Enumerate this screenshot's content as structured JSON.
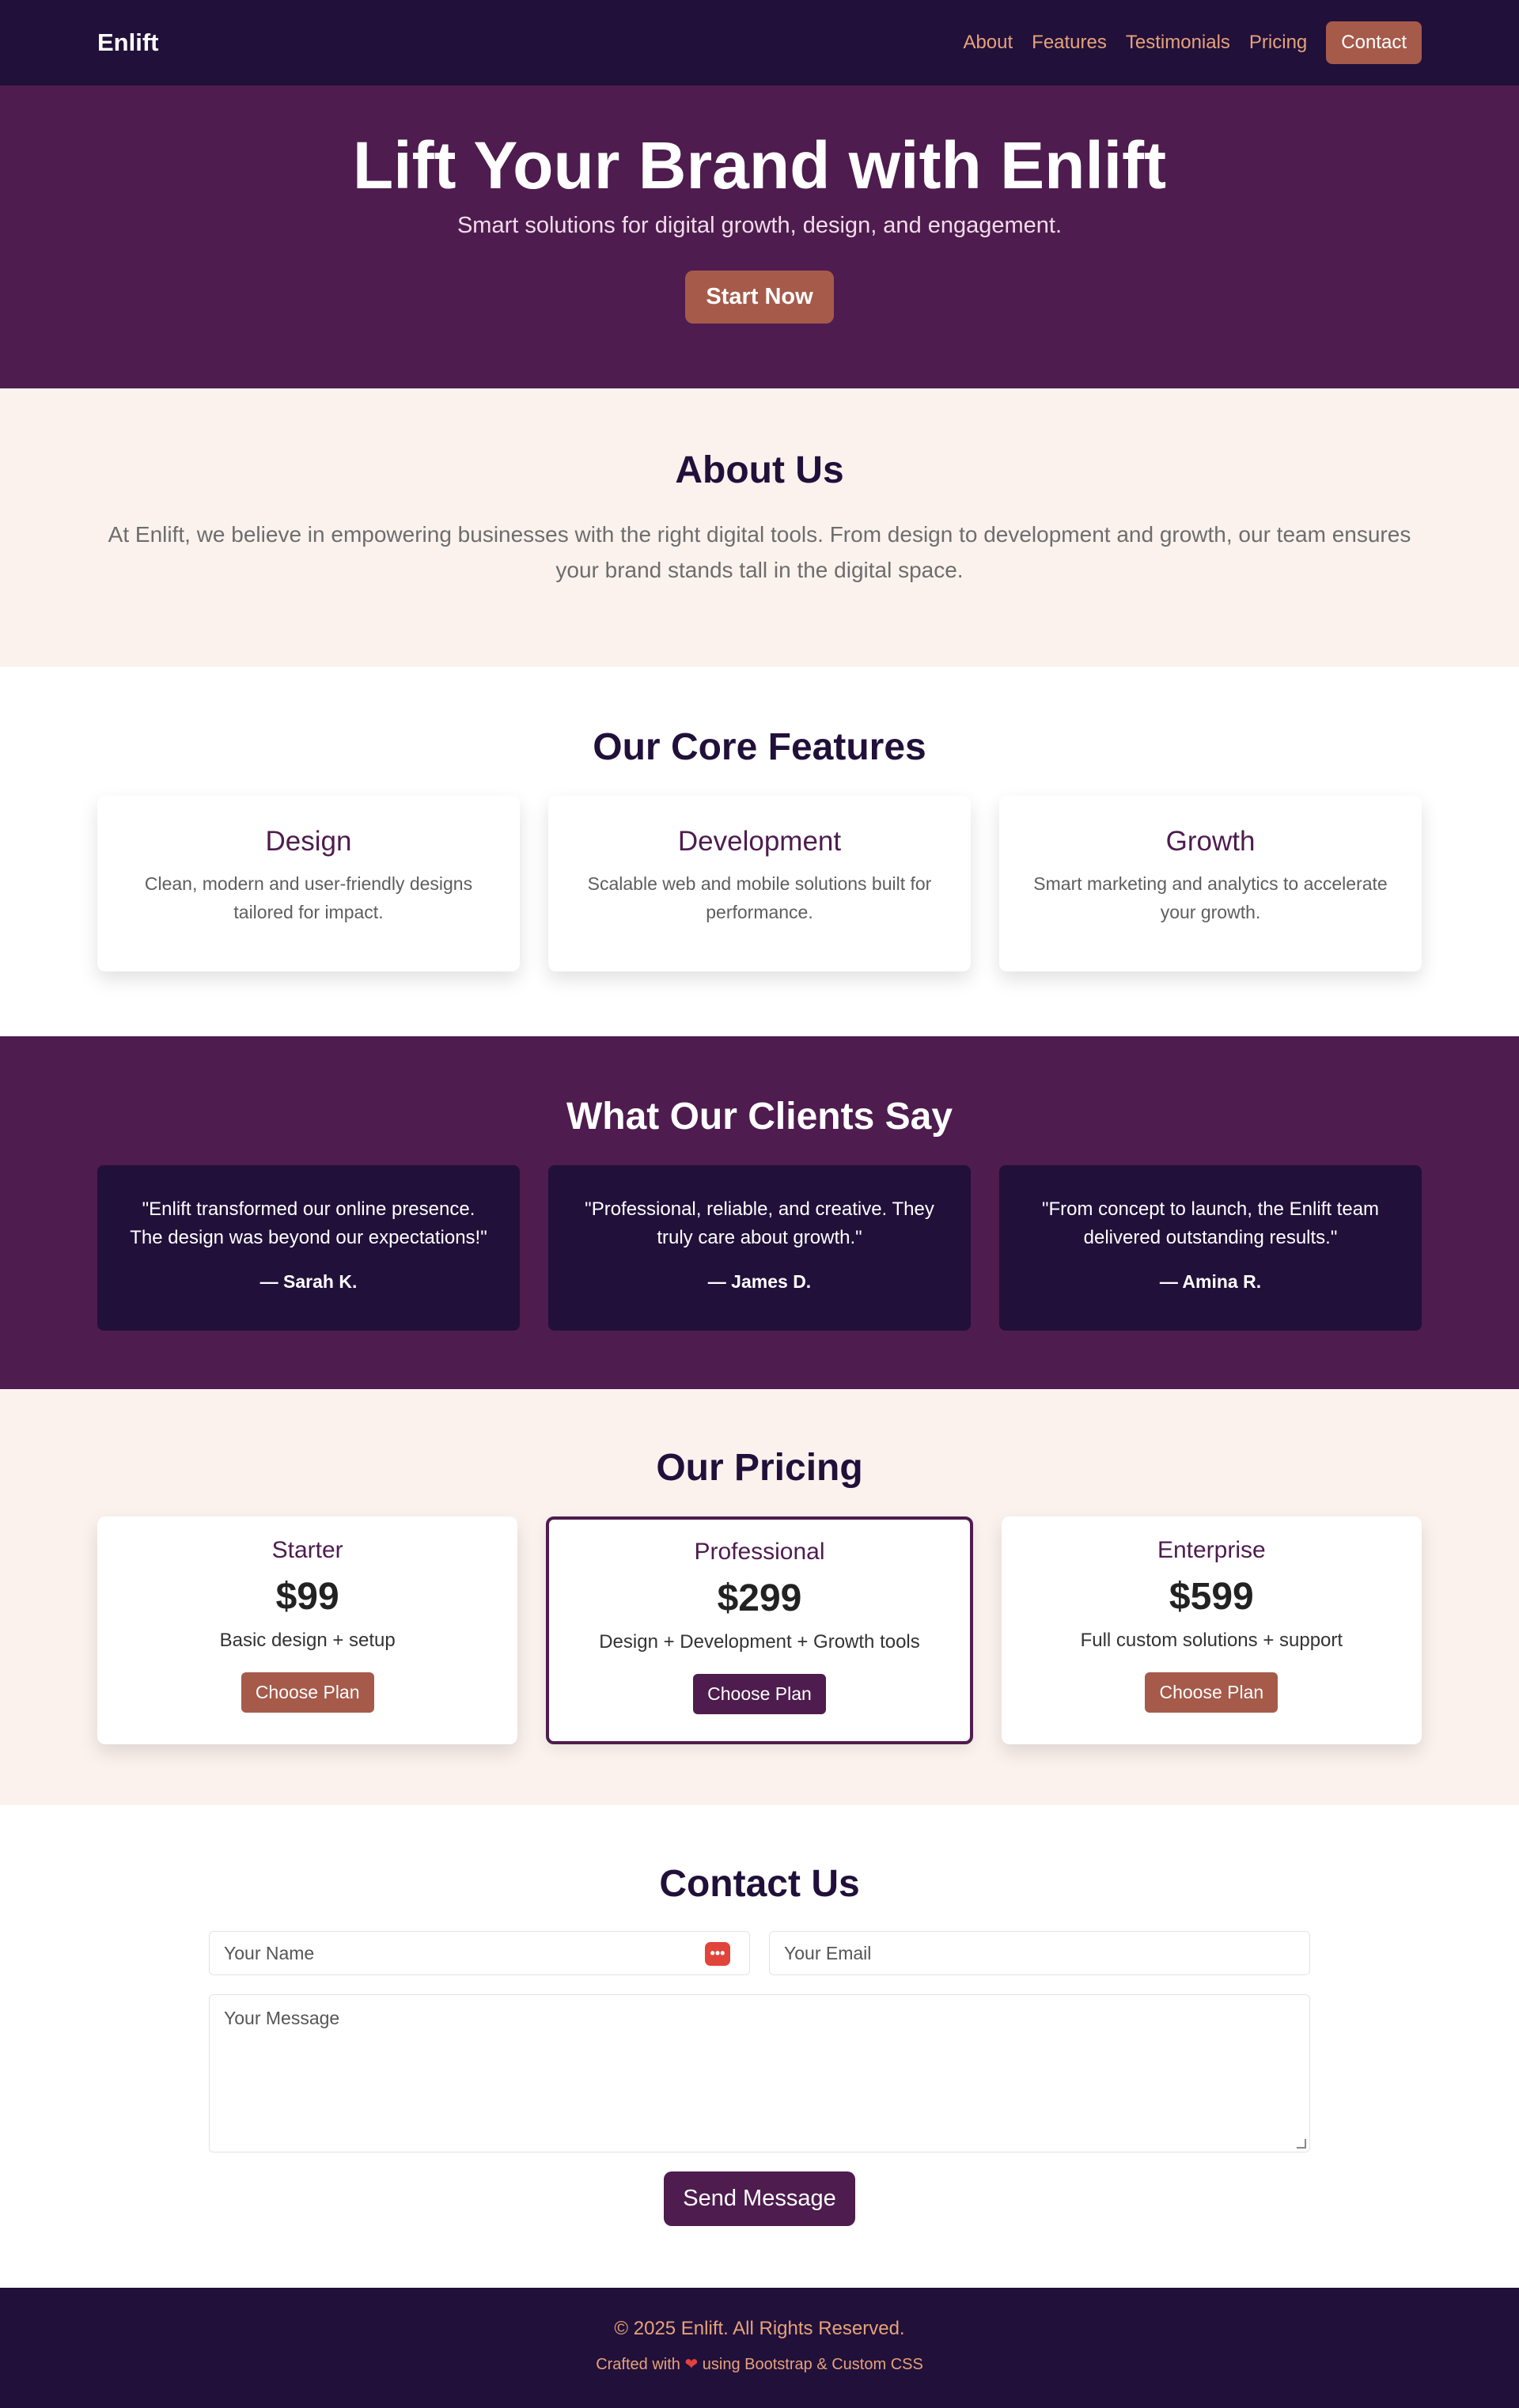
{
  "nav": {
    "brand": "Enlift",
    "links": [
      "About",
      "Features",
      "Testimonials",
      "Pricing"
    ],
    "contact": "Contact"
  },
  "hero": {
    "title": "Lift Your Brand with Enlift",
    "subtitle": "Smart solutions for digital growth, design, and engagement.",
    "cta": "Start Now"
  },
  "about": {
    "title": "About Us",
    "text": "At Enlift, we believe in empowering businesses with the right digital tools. From design to development and growth, our team ensures your brand stands tall in the digital space."
  },
  "features": {
    "title": "Our Core Features",
    "items": [
      {
        "title": "Design",
        "text": "Clean, modern and user-friendly designs tailored for impact."
      },
      {
        "title": "Development",
        "text": "Scalable web and mobile solutions built for performance."
      },
      {
        "title": "Growth",
        "text": "Smart marketing and analytics to accelerate your growth."
      }
    ]
  },
  "testimonials": {
    "title": "What Our Clients Say",
    "items": [
      {
        "quote": "\"Enlift transformed our online presence. The design was beyond our expectations!\"",
        "author": "— Sarah K."
      },
      {
        "quote": "\"Professional, reliable, and creative. They truly care about growth.\"",
        "author": "— James D."
      },
      {
        "quote": "\"From concept to launch, the Enlift team delivered outstanding results.\"",
        "author": "— Amina R."
      }
    ]
  },
  "pricing": {
    "title": "Our Pricing",
    "plans": [
      {
        "name": "Starter",
        "price": "$99",
        "desc": "Basic design + setup",
        "button": "Choose Plan"
      },
      {
        "name": "Professional",
        "price": "$299",
        "desc": "Design + Development + Growth tools",
        "button": "Choose Plan"
      },
      {
        "name": "Enterprise",
        "price": "$599",
        "desc": "Full custom solutions + support",
        "button": "Choose Plan"
      }
    ]
  },
  "contact": {
    "title": "Contact Us",
    "name_placeholder": "Your Name",
    "email_placeholder": "Your Email",
    "message_placeholder": "Your Message",
    "button": "Send Message"
  },
  "footer": {
    "copyright": "© 2025 Enlift. All Rights Reserved.",
    "crafted_prefix": "Crafted with",
    "crafted_suffix": "using Bootstrap & Custom CSS"
  },
  "colors": {
    "dark": "#21103a",
    "purple": "#4e1c4e",
    "accent": "#a65a4a",
    "cream": "#fbf2ee"
  }
}
